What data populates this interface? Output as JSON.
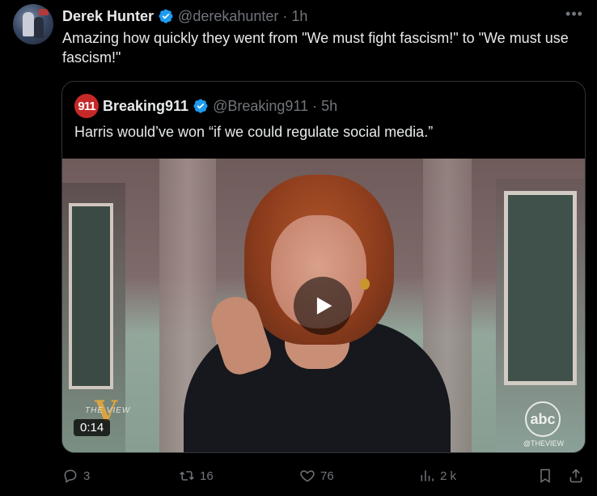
{
  "author": {
    "name": "Derek Hunter",
    "handle": "@derekahunter",
    "time": "1h",
    "text": "Amazing how quickly they went from \"We must fight fascism!\" to \"We must use fascism!\""
  },
  "quoted": {
    "avatar_text": "911",
    "name": "Breaking911",
    "handle": "@Breaking911",
    "time": "5h",
    "text": "Harris would’ve won “if we could regulate social media.”",
    "video": {
      "duration": "0:14",
      "show_logo": "THE VIEW",
      "network_logo": "abc",
      "network_sub": "@THEVIEW"
    }
  },
  "actions": {
    "replies": "3",
    "reposts": "16",
    "likes": "76",
    "views": "2 k"
  },
  "colors": {
    "background": "#000000",
    "text": "#e7e9ea",
    "muted": "#71767b",
    "verified": "#1d9bf0",
    "border": "#2f3336"
  },
  "icons": {
    "verified": "verified-badge-icon",
    "more": "more-icon",
    "reply": "reply-icon",
    "repost": "repost-icon",
    "like": "heart-icon",
    "views": "views-icon",
    "bookmark": "bookmark-icon",
    "share": "share-icon",
    "play": "play-icon"
  }
}
